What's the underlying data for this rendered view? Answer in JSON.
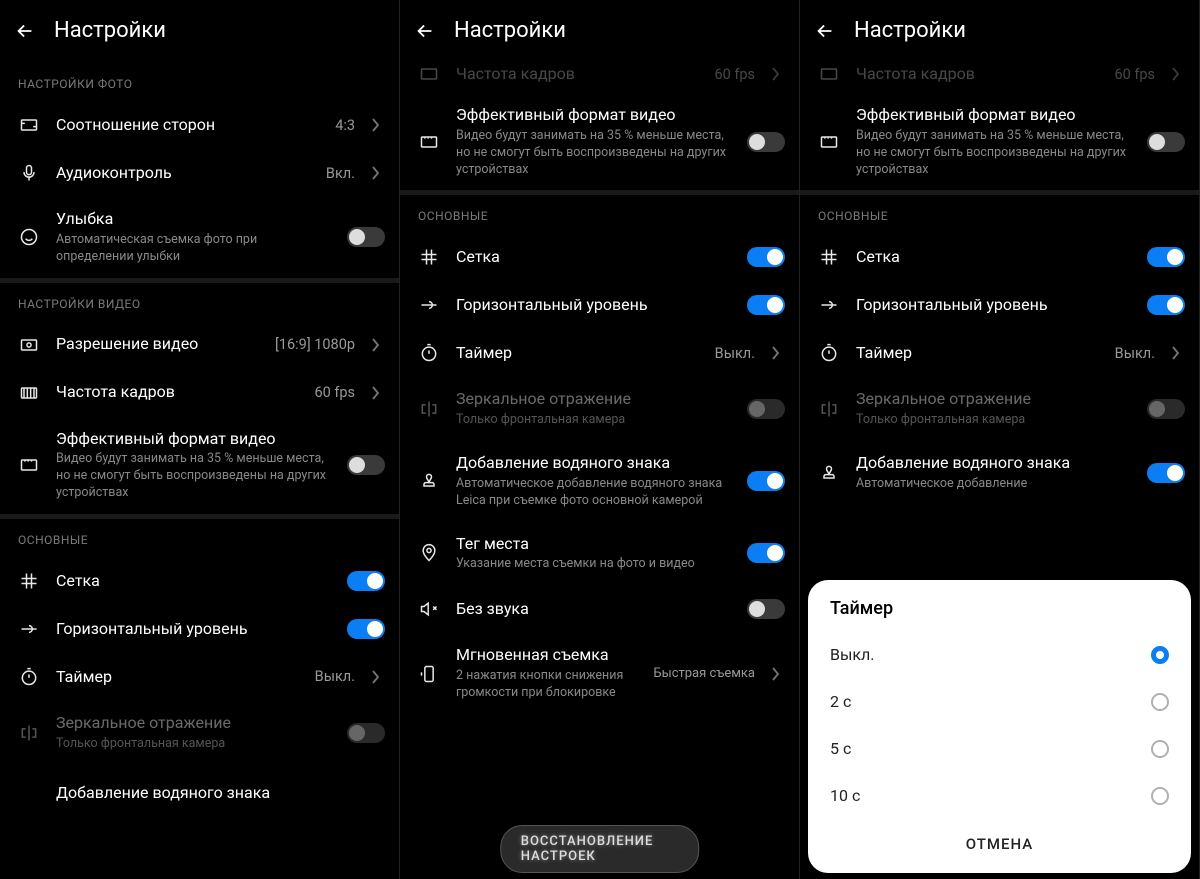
{
  "header": {
    "title": "Настройки"
  },
  "p1": {
    "sec_photo": "НАСТРОЙКИ ФОТО",
    "aspect": {
      "label": "Соотношение сторон",
      "value": "4:3"
    },
    "audio": {
      "label": "Аудиоконтроль",
      "value": "Вкл."
    },
    "smile": {
      "label": "Улыбка",
      "sub": "Автоматическая съемка фото при определении улыбки"
    },
    "sec_video": "НАСТРОЙКИ ВИДЕО",
    "res": {
      "label": "Разрешение видео",
      "value": "[16:9] 1080p"
    },
    "fps": {
      "label": "Частота кадров",
      "value": "60 fps"
    },
    "eff": {
      "label": "Эффективный формат видео",
      "sub": "Видео будут занимать на 35 % меньше места, но не смогут быть воспроизведены на других устройствах"
    },
    "sec_main": "ОСНОВНЫЕ",
    "grid": {
      "label": "Сетка"
    },
    "level": {
      "label": "Горизонтальный уровень"
    },
    "timer": {
      "label": "Таймер",
      "value": "Выкл."
    },
    "mirror": {
      "label": "Зеркальное отражение",
      "sub": "Только фронтальная камера"
    },
    "watermark": {
      "label": "Добавление водяного знака"
    }
  },
  "p2": {
    "cut": {
      "label": "Частота кадров",
      "value": "60 fps"
    },
    "eff": {
      "label": "Эффективный формат видео",
      "sub": "Видео будут занимать на 35 % меньше места, но не смогут быть воспроизведены на других устройствах"
    },
    "sec_main": "ОСНОВНЫЕ",
    "grid": {
      "label": "Сетка"
    },
    "level": {
      "label": "Горизонтальный уровень"
    },
    "timer": {
      "label": "Таймер",
      "value": "Выкл."
    },
    "mirror": {
      "label": "Зеркальное отражение",
      "sub": "Только фронтальная камера"
    },
    "watermark": {
      "label": "Добавление водяного знака",
      "sub": "Автоматическое добавление водяного знака Leica при съемке фото основной камерой"
    },
    "geotag": {
      "label": "Тег места",
      "sub": "Указание места съемки на фото и видео"
    },
    "mute": {
      "label": "Без звука"
    },
    "instant": {
      "label": "Мгновенная съемка",
      "sub": "2 нажатия кнопки снижения громкости при блокировке",
      "value": "Быстрая съемка"
    },
    "reset": "ВОССТАНОВЛЕНИЕ НАСТРОЕК"
  },
  "p3": {
    "cut": {
      "label": "Частота кадров",
      "value": "60 fps"
    },
    "eff": {
      "label": "Эффективный формат видео",
      "sub": "Видео будут занимать на 35 % меньше места, но не смогут быть воспроизведены на других устройствах"
    },
    "sec_main": "ОСНОВНЫЕ",
    "grid": {
      "label": "Сетка"
    },
    "level": {
      "label": "Горизонтальный уровень"
    },
    "timer": {
      "label": "Таймер",
      "value": "Выкл."
    },
    "mirror": {
      "label": "Зеркальное отражение",
      "sub": "Только фронтальная камера"
    },
    "watermark": {
      "label": "Добавление водяного знака",
      "sub": "Автоматическое добавление"
    },
    "sheet": {
      "title": "Таймер",
      "opt0": "Выкл.",
      "opt1": "2 с",
      "opt2": "5 с",
      "opt3": "10 с",
      "cancel": "ОТМЕНА"
    }
  }
}
